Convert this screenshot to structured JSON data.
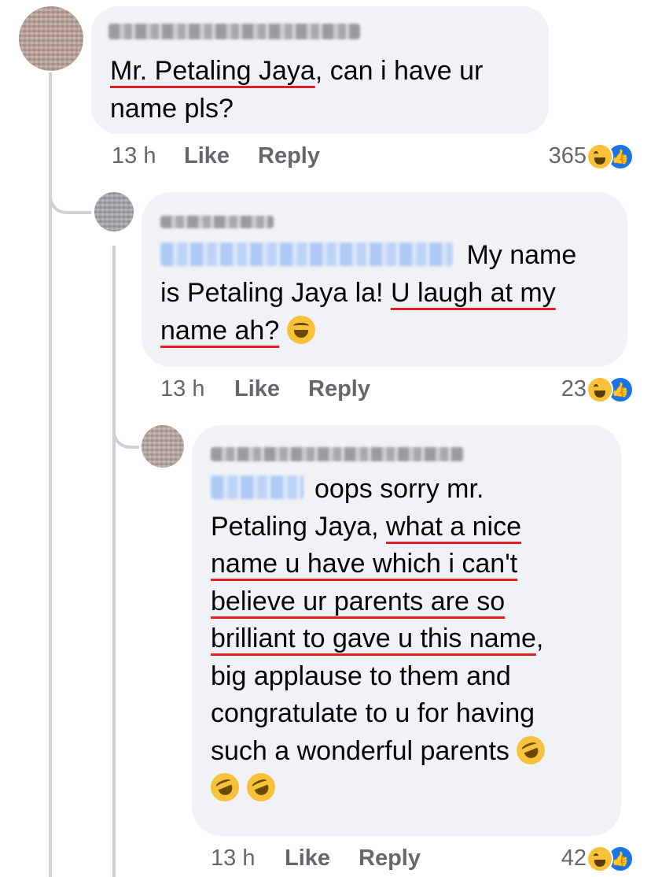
{
  "comments": [
    {
      "text_line1_underlined": "Mr. Petaling Jaya",
      "text_line1_rest": ", can i have ur",
      "text_line2": "name pls?",
      "time": "13 h",
      "like_label": "Like",
      "reply_label": "Reply",
      "reaction_count": "365",
      "reactions": [
        "haha-icon",
        "like-icon"
      ]
    },
    {
      "line1_rest": " My name",
      "line2_plain": "is Petaling Jaya la! ",
      "line2_underlined": "U laugh at my",
      "line3_underlined": "name ah?",
      "line3_emoji": "laughing-tears-emoji",
      "time": "13 h",
      "like_label": "Like",
      "reply_label": "Reply",
      "reaction_count": "23",
      "reactions": [
        "haha-icon",
        "like-icon"
      ]
    },
    {
      "line1_rest": "oops sorry mr.",
      "line2_plain": "Petaling Jaya, ",
      "line2_underlined": "what a nice",
      "line3_underlined": "name u have which i can't",
      "line4_underlined": "believe ur parents are so",
      "line5_underlined": "brilliant to gave u this name",
      "line5_rest": ",",
      "line6": "big applause to them and",
      "line7": "congratulate to u for having",
      "line8": "such a wonderful parents",
      "trailing_emojis": [
        "rolling-laughing-emoji",
        "rolling-laughing-emoji",
        "rolling-laughing-emoji"
      ],
      "time": "13 h",
      "like_label": "Like",
      "reply_label": "Reply",
      "reaction_count": "42",
      "reactions": [
        "haha-icon",
        "like-icon"
      ]
    }
  ]
}
